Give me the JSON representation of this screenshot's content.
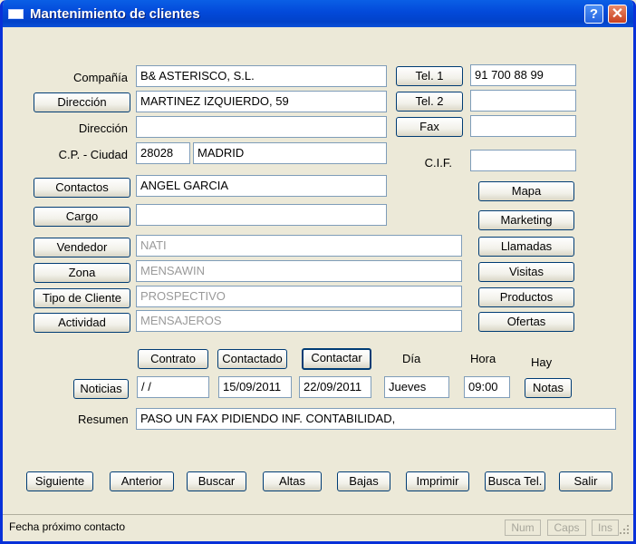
{
  "window": {
    "title": "Mantenimiento de clientes",
    "help": "?",
    "close": "✕"
  },
  "labels": {
    "compania": "Compañía",
    "direccion2": "Dirección",
    "cp_ciudad": "C.P. - Ciudad",
    "cif": "C.I.F.",
    "dia": "Día",
    "hora": "Hora",
    "hay": "Hay",
    "resumen": "Resumen"
  },
  "fields": {
    "compania": "B& ASTERISCO, S.L.",
    "direccion": "MARTINEZ IZQUIERDO, 59",
    "direccion2": "",
    "cp": "28028",
    "ciudad": "MADRID",
    "contactos": "ANGEL GARCIA",
    "cargo": "",
    "vendedor": "NATI",
    "zona": "MENSAWIN",
    "tipo_cliente": "PROSPECTIVO",
    "actividad": "MENSAJEROS",
    "tel1": "91 700 88 99",
    "tel2": "",
    "fax": "",
    "cif": "",
    "noticias_fecha": " / /",
    "fecha_contactado": "15/09/2011",
    "fecha_contactar": "22/09/2011",
    "dia": "Jueves",
    "hora": "09:00",
    "resumen": "PASO UN FAX PIDIENDO INF. CONTABILIDAD,"
  },
  "buttons": {
    "direccion": "Dirección",
    "contactos": "Contactos",
    "cargo": "Cargo",
    "vendedor": "Vendedor",
    "zona": "Zona",
    "tipo_cliente": "Tipo de Cliente",
    "actividad": "Actividad",
    "tel1": "Tel. 1",
    "tel2": "Tel. 2",
    "fax": "Fax",
    "mapa": "Mapa",
    "marketing": "Marketing",
    "llamadas": "Llamadas",
    "visitas": "Visitas",
    "productos": "Productos",
    "ofertas": "Ofertas",
    "contrato": "Contrato",
    "contactado": "Contactado",
    "contactar": "Contactar",
    "noticias": "Noticias",
    "notas": "Notas",
    "siguiente": "Siguiente",
    "anterior": "Anterior",
    "buscar": "Buscar",
    "altas": "Altas",
    "bajas": "Bajas",
    "imprimir": "Imprimir",
    "busca_tel": "Busca Tel.",
    "salir": "Salir"
  },
  "status": {
    "text": "Fecha próximo contacto",
    "num": "Num",
    "caps": "Caps",
    "ins": "Ins"
  }
}
